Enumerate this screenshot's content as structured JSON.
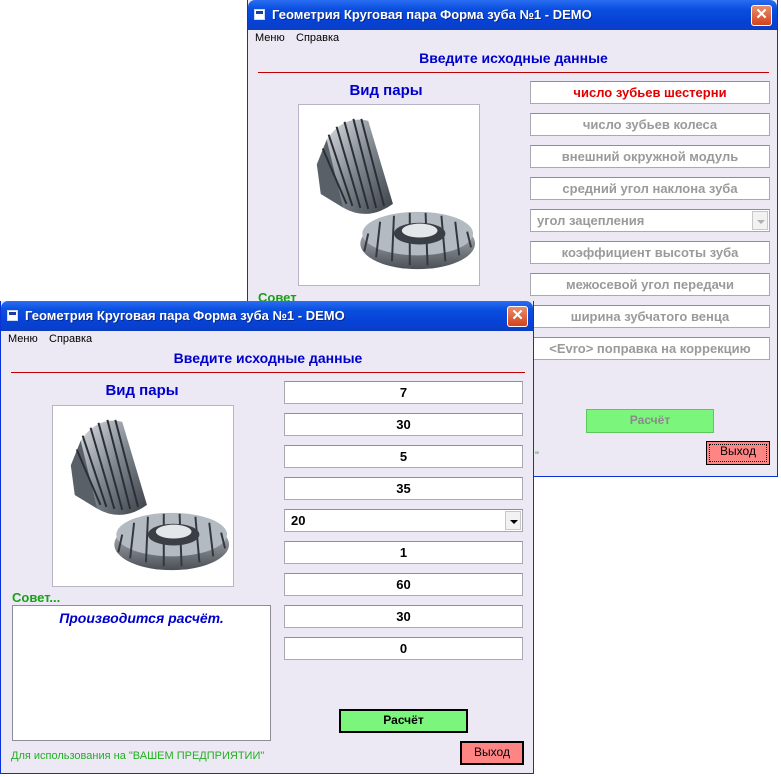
{
  "window_title": "Геометрия Круговая пара Форма зуба №1 - DEMO",
  "menu": [
    "Меню",
    "Справка"
  ],
  "heading": "Введите исходные данные",
  "pair_view_label": "Вид пары",
  "advice_label": "Совет...",
  "advice_label_back": "Совет",
  "advice_message": "Производится расчёт.",
  "footer_text": "Для использования на  \"ВАШЕМ ПРЕДПРИЯТИИ\"",
  "footer_tail": "\"",
  "close_glyph": "✕",
  "parameters": [
    {
      "label": "число зубьев шестерни",
      "value": "7"
    },
    {
      "label": "число зубьев колеса",
      "value": "30"
    },
    {
      "label": "внешний окружной модуль",
      "value": "5"
    },
    {
      "label": "средний угол наклона зуба",
      "value": "35"
    },
    {
      "label": "угол зацепления",
      "value": "20"
    },
    {
      "label": "коэффициент высоты зуба",
      "value": "1"
    },
    {
      "label": "межосевой угол передачи",
      "value": "60"
    },
    {
      "label": "ширина зубчатого венца",
      "value": "30"
    },
    {
      "label": "<Evro> поправка на коррекцию",
      "value": "0"
    }
  ],
  "buttons": {
    "calculate": "Расчёт",
    "exit": "Выход"
  },
  "colors": {
    "title_bar": "#0a4fde",
    "heading": "#0000cc",
    "active_label": "#e00000",
    "calc_button": "#7cf57c",
    "exit_button": "#ff8484",
    "advice": "#18a018"
  },
  "icons": [
    "app-icon",
    "close-icon",
    "dropdown-arrow-icon",
    "bevel-gear-image"
  ]
}
